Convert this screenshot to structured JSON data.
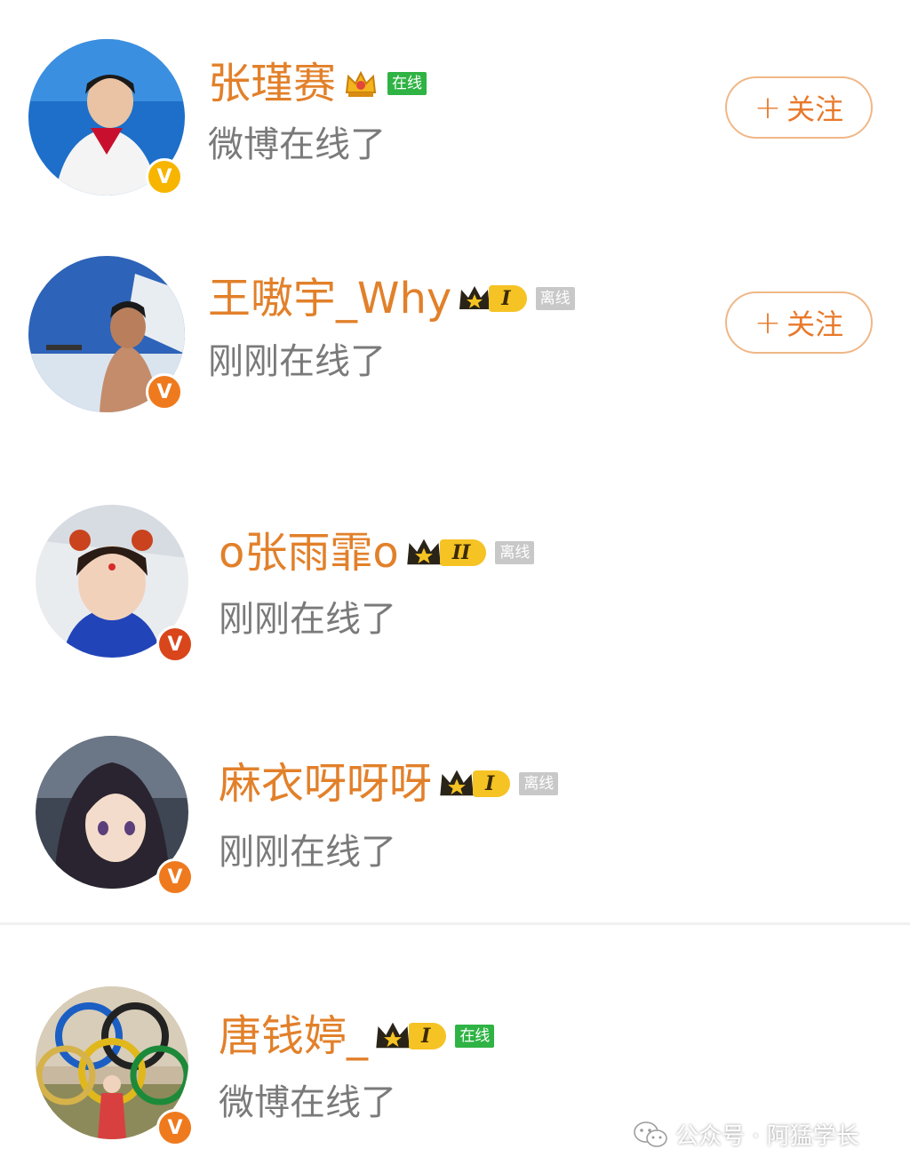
{
  "users": [
    {
      "name": "张瑾赛",
      "status": "微博在线了",
      "online_label": "在线",
      "level": "",
      "follow_label": "关注"
    },
    {
      "name": "王嗷宇_Why",
      "status": "刚刚在线了",
      "online_label": "离线",
      "level": "I",
      "follow_label": "关注"
    },
    {
      "name": "o张雨霏o",
      "status": "刚刚在线了",
      "online_label": "离线",
      "level": "II"
    },
    {
      "name": "麻衣呀呀呀",
      "status": "刚刚在线了",
      "online_label": "离线",
      "level": "I"
    },
    {
      "name": "唐钱婷_",
      "status": "微博在线了",
      "online_label": "在线",
      "level": "I"
    }
  ],
  "follow_plus": "+",
  "verified_mark": "V",
  "watermark": "公众号 · 阿猛学长",
  "colors": {
    "name": "#e2802a",
    "status": "#7a7a7a",
    "online": "#2fb344",
    "offline": "#c8c8c8",
    "follow_border": "#f0b787",
    "follow_text": "#e8792a",
    "level_pill": "#f6c324",
    "verified_gold": "#f7b500",
    "verified_orange": "#ef7a1e"
  }
}
